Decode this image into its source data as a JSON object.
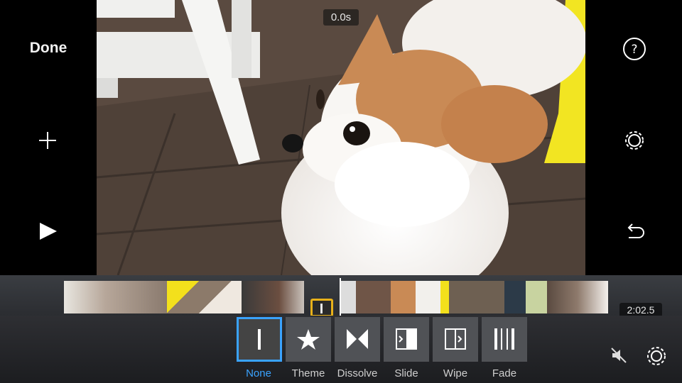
{
  "left_bar": {
    "done_label": "Done"
  },
  "viewer": {
    "time": "0.0s"
  },
  "timeline": {
    "duration": "2:02.5"
  },
  "transitions": [
    {
      "label": "None",
      "icon": "none-transition-icon",
      "selected": true
    },
    {
      "label": "Theme",
      "icon": "star-icon",
      "selected": false
    },
    {
      "label": "Dissolve",
      "icon": "dissolve-icon",
      "selected": false
    },
    {
      "label": "Slide",
      "icon": "slide-icon",
      "selected": false
    },
    {
      "label": "Wipe",
      "icon": "wipe-icon",
      "selected": false
    },
    {
      "label": "Fade",
      "icon": "fade-icon",
      "selected": false
    }
  ],
  "icons": {
    "add": "plus-icon",
    "play": "play-icon",
    "help": "help-icon",
    "settings": "gear-icon",
    "undo": "undo-icon",
    "mute": "speaker-muted-icon"
  },
  "colors": {
    "accent": "#3aa3ff",
    "transition_marker": "#e8b11a"
  }
}
